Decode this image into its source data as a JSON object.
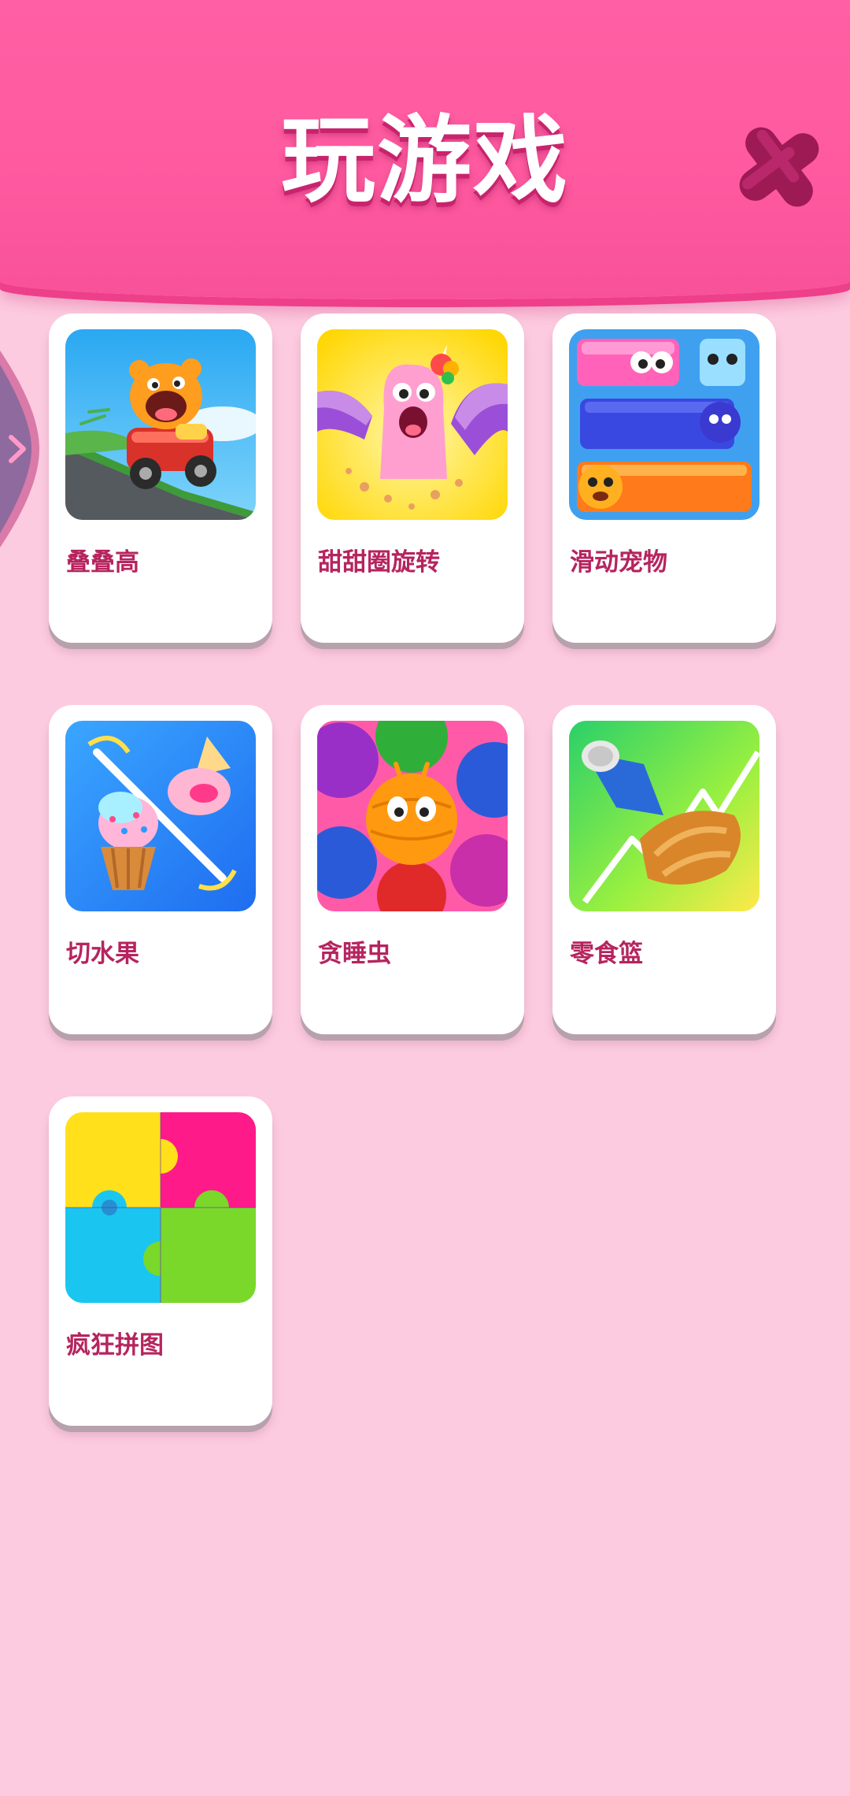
{
  "header": {
    "title": "玩游戏",
    "close_icon": "close-x-icon",
    "colors": {
      "header": "#ff5aa0",
      "background": "#fdcbe0",
      "label": "#b6245f",
      "close": "#9e1a55"
    }
  },
  "side_tab": {
    "icon": "chevron-right-icon"
  },
  "games": [
    {
      "label": "叠叠高",
      "icon": "monster-kart-game-icon"
    },
    {
      "label": "甜甜圈旋转",
      "icon": "unicorn-donut-game-icon"
    },
    {
      "label": "滑动宠物",
      "icon": "sliding-pets-game-icon"
    },
    {
      "label": "切水果",
      "icon": "slice-ice-cream-game-icon"
    },
    {
      "label": "贪睡虫",
      "icon": "sleepy-yarn-bugs-game-icon"
    },
    {
      "label": "零食篮",
      "icon": "snack-basket-game-icon"
    },
    {
      "label": "疯狂拼图",
      "icon": "jigsaw-puzzle-game-icon"
    }
  ]
}
